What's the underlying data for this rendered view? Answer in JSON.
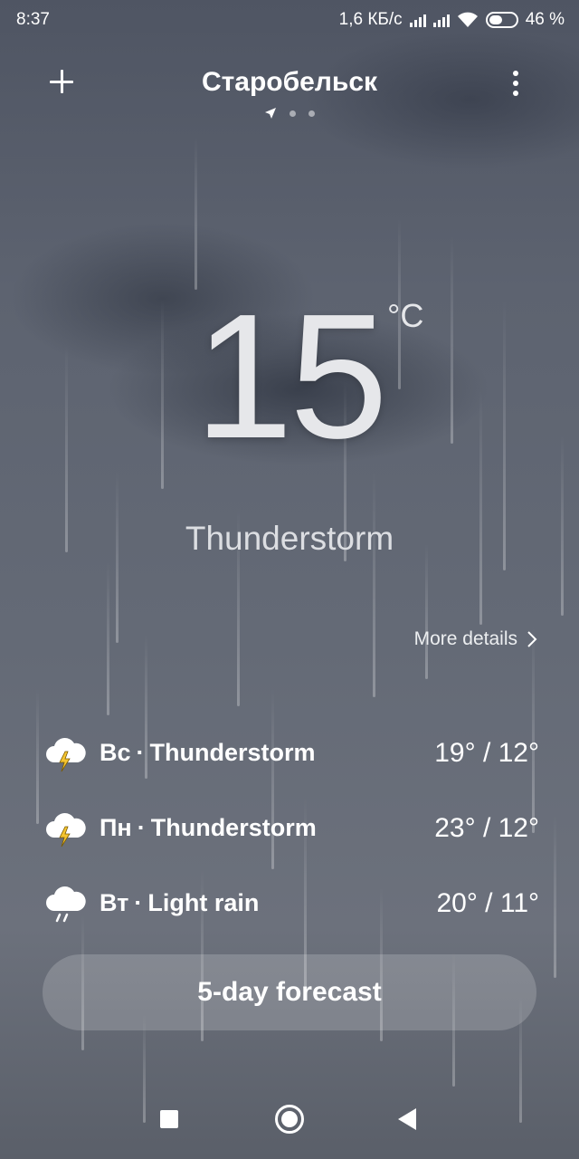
{
  "status_bar": {
    "time": "8:37",
    "net_speed": "1,6 КБ/с",
    "battery": "46 %"
  },
  "header": {
    "city": "Старобельск",
    "add_icon": "plus-icon",
    "menu_icon": "more-vertical-icon",
    "page_indicator": {
      "pages": 3,
      "current": 1,
      "current_icon": "location-arrow-icon"
    }
  },
  "current": {
    "temperature": "15",
    "unit": "°C",
    "condition": "Thunderstorm"
  },
  "more_details": "More details",
  "daily": [
    {
      "day": "Вс",
      "separator": "·",
      "condition": "Thunderstorm",
      "temps": "19° / 12°",
      "icon": "thunderstorm-icon"
    },
    {
      "day": "Пн",
      "separator": "·",
      "condition": "Thunderstorm",
      "temps": "23° / 12°",
      "icon": "thunderstorm-icon"
    },
    {
      "day": "Вт",
      "separator": "·",
      "condition": "Light rain",
      "temps": "20° / 11°",
      "icon": "light-rain-icon"
    }
  ],
  "forecast_button": "5-day forecast",
  "colors": {
    "background_top": "#4f5563",
    "background_bottom": "#6c717c",
    "bolt": "#f4c430"
  }
}
